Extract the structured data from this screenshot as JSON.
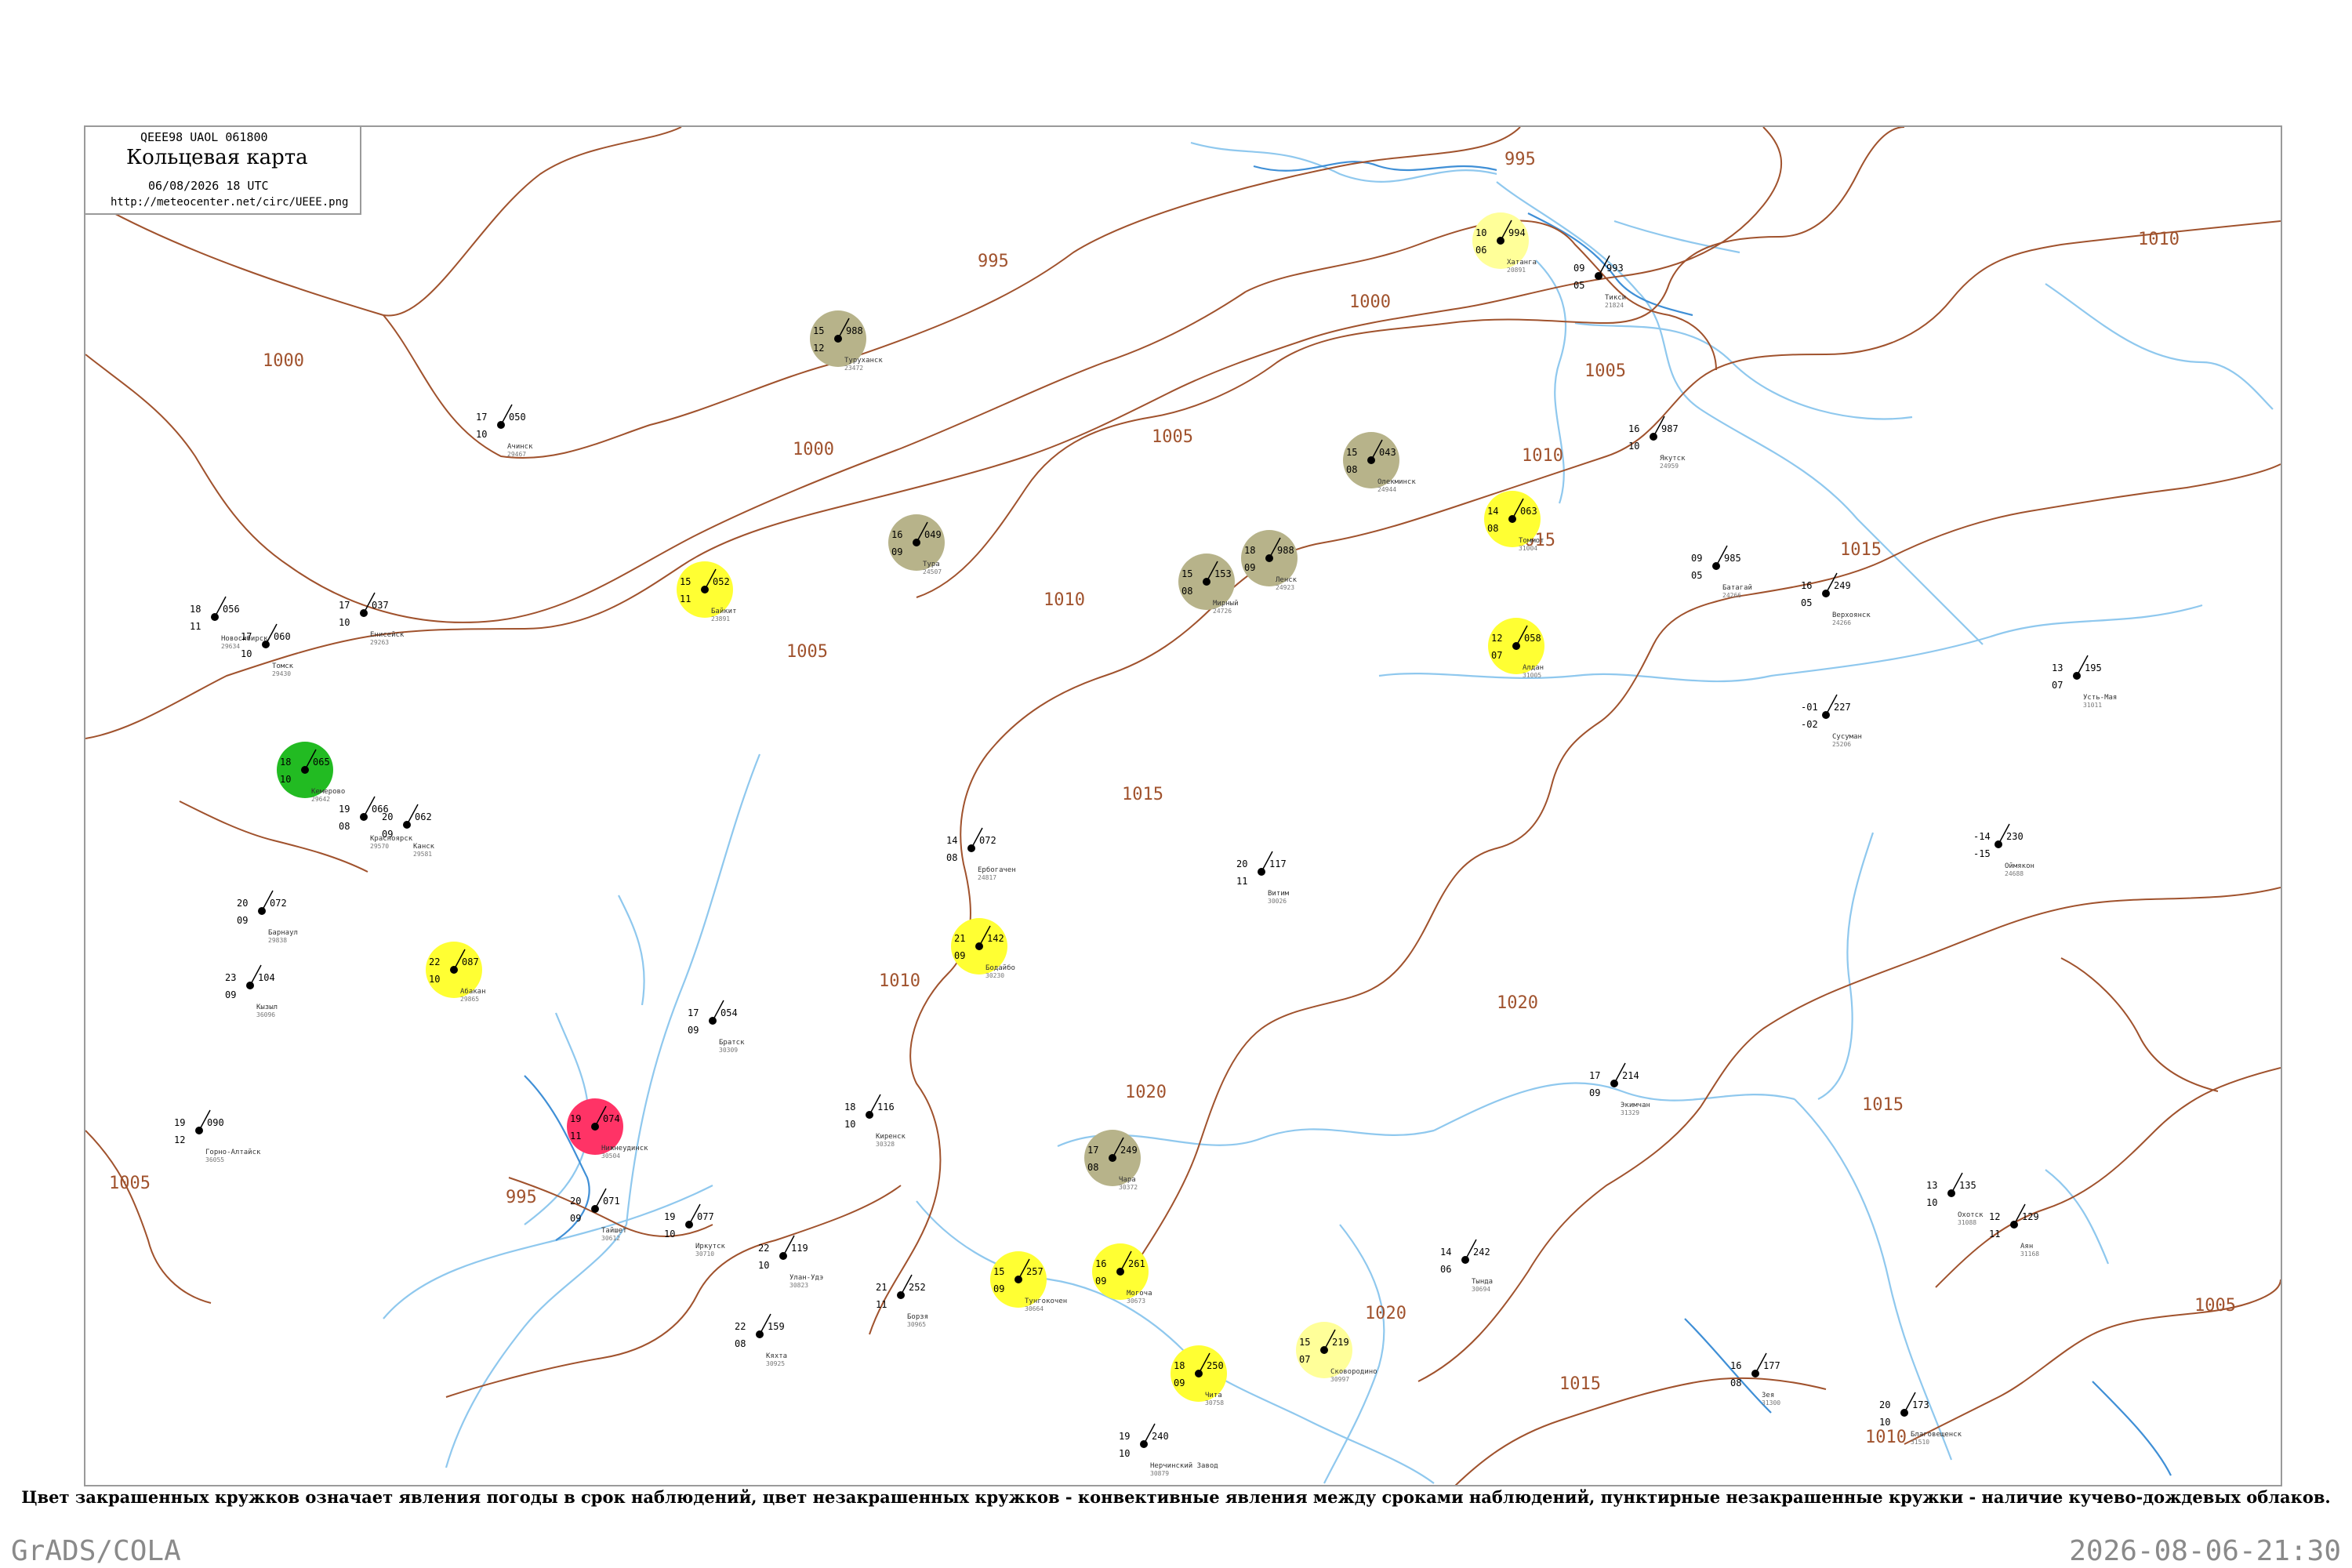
{
  "header": {
    "code_line": "QEEE98  UAOL  061800",
    "title": "Кольцевая карта",
    "datetime": "06/08/2026 18 UTC",
    "url": "http://meteocenter.net/circ/UEEE.png"
  },
  "isobars": {
    "color": "#a0522d",
    "labels": [
      "995",
      "995",
      "1000",
      "1000",
      "1000",
      "1005",
      "1005",
      "1005",
      "1010",
      "1010",
      "1010",
      "1010",
      "1015",
      "1015",
      "1015",
      "1015",
      "1020",
      "1020",
      "1020",
      "1015",
      "1010",
      "1005",
      "995",
      "1005"
    ]
  },
  "stations": [
    {
      "name": "Якутск",
      "index": "24959",
      "temp": "16",
      "dew": "10",
      "pressure": "987",
      "weather_color": "#ffffff"
    },
    {
      "name": "Олекминск",
      "index": "24944",
      "temp": "15",
      "dew": "08",
      "pressure": "043",
      "weather_color": "#b7b38a"
    },
    {
      "name": "Батагай",
      "index": "24266",
      "temp": "09",
      "dew": "05",
      "pressure": "985",
      "weather_color": "#ffffff"
    },
    {
      "name": "Томмот",
      "index": "31004",
      "temp": "14",
      "dew": "08",
      "pressure": "063",
      "weather_color": "#ffff33"
    },
    {
      "name": "Алдан",
      "index": "31005",
      "temp": "12",
      "dew": "07",
      "pressure": "058",
      "weather_color": "#ffff33"
    },
    {
      "name": "Усть-Мая",
      "index": "31011",
      "temp": "13",
      "dew": "07",
      "pressure": "195",
      "weather_color": "#ffffff"
    },
    {
      "name": "Оймякон",
      "index": "24688",
      "temp": "-14",
      "dew": "-15",
      "pressure": "230",
      "weather_color": "#ffffff"
    },
    {
      "name": "Верхоянск",
      "index": "24266",
      "temp": "16",
      "dew": "05",
      "pressure": "249",
      "weather_color": "#ffffff"
    },
    {
      "name": "Ленск",
      "index": "24923",
      "temp": "18",
      "dew": "09",
      "pressure": "988",
      "weather_color": "#b7b38a"
    },
    {
      "name": "Мирный",
      "index": "24726",
      "temp": "15",
      "dew": "08",
      "pressure": "153",
      "weather_color": "#b7b38a"
    },
    {
      "name": "Витим",
      "index": "30026",
      "temp": "20",
      "dew": "11",
      "pressure": "117",
      "weather_color": "#ffffff"
    },
    {
      "name": "Бодайбо",
      "index": "30230",
      "temp": "21",
      "dew": "09",
      "pressure": "142",
      "weather_color": "#ffff33"
    },
    {
      "name": "Чара",
      "index": "30372",
      "temp": "17",
      "dew": "08",
      "pressure": "249",
      "weather_color": "#b7b38a"
    },
    {
      "name": "Тунгокочен",
      "index": "30664",
      "temp": "15",
      "dew": "09",
      "pressure": "257",
      "weather_color": "#ffff33"
    },
    {
      "name": "Чита",
      "index": "30758",
      "temp": "18",
      "dew": "09",
      "pressure": "250",
      "weather_color": "#ffff33"
    },
    {
      "name": "Могоча",
      "index": "30673",
      "temp": "16",
      "dew": "09",
      "pressure": "261",
      "weather_color": "#ffff33"
    },
    {
      "name": "Тында",
      "index": "30694",
      "temp": "14",
      "dew": "06",
      "pressure": "242",
      "weather_color": "#ffffff"
    },
    {
      "name": "Иркутск",
      "index": "30710",
      "temp": "19",
      "dew": "10",
      "pressure": "077",
      "weather_color": "#ffffff"
    },
    {
      "name": "Улан-Удэ",
      "index": "30823",
      "temp": "22",
      "dew": "10",
      "pressure": "119",
      "weather_color": "#ffffff"
    },
    {
      "name": "Братск",
      "index": "30309",
      "temp": "17",
      "dew": "09",
      "pressure": "054",
      "weather_color": "#ffffff"
    },
    {
      "name": "Киренск",
      "index": "30328",
      "temp": "18",
      "dew": "10",
      "pressure": "116",
      "weather_color": "#ffffff"
    },
    {
      "name": "Ербогачен",
      "index": "24817",
      "temp": "14",
      "dew": "08",
      "pressure": "072",
      "weather_color": "#ffffff"
    },
    {
      "name": "Туруханск",
      "index": "23472",
      "temp": "15",
      "dew": "12",
      "pressure": "988",
      "weather_color": "#b7b38a"
    },
    {
      "name": "Тура",
      "index": "24507",
      "temp": "16",
      "dew": "09",
      "pressure": "049",
      "weather_color": "#b7b38a"
    },
    {
      "name": "Байкит",
      "index": "23891",
      "temp": "15",
      "dew": "11",
      "pressure": "052",
      "weather_color": "#ffff33"
    },
    {
      "name": "Енисейск",
      "index": "29263",
      "temp": "17",
      "dew": "10",
      "pressure": "037",
      "weather_color": "#ffffff"
    },
    {
      "name": "Красноярск",
      "index": "29570",
      "temp": "19",
      "dew": "08",
      "pressure": "066",
      "weather_color": "#ffffff"
    },
    {
      "name": "Канск",
      "index": "29581",
      "temp": "20",
      "dew": "09",
      "pressure": "062",
      "weather_color": "#ffffff"
    },
    {
      "name": "Абакан",
      "index": "29865",
      "temp": "22",
      "dew": "10",
      "pressure": "087",
      "weather_color": "#ffff33"
    },
    {
      "name": "Кызыл",
      "index": "36096",
      "temp": "23",
      "dew": "09",
      "pressure": "104",
      "weather_color": "#ffffff"
    },
    {
      "name": "Хатанга",
      "index": "20891",
      "temp": "10",
      "dew": "06",
      "pressure": "994",
      "weather_color": "#ffff99"
    },
    {
      "name": "Тикси",
      "index": "21824",
      "temp": "09",
      "dew": "05",
      "pressure": "993",
      "weather_color": "#ffffff"
    },
    {
      "name": "Сусуман",
      "index": "25206",
      "temp": "-01",
      "dew": "-02",
      "pressure": "227",
      "weather_color": "#ffffff"
    },
    {
      "name": "Зея",
      "index": "31300",
      "temp": "16",
      "dew": "08",
      "pressure": "177",
      "weather_color": "#ffffff"
    },
    {
      "name": "Благовещенск",
      "index": "31510",
      "temp": "20",
      "dew": "10",
      "pressure": "173",
      "weather_color": "#ffffff"
    },
    {
      "name": "Сковородино",
      "index": "30997",
      "temp": "15",
      "dew": "07",
      "pressure": "219",
      "weather_color": "#ffff99"
    },
    {
      "name": "Нерчинский Завод",
      "index": "30879",
      "temp": "19",
      "dew": "10",
      "pressure": "240",
      "weather_color": "#ffffff"
    },
    {
      "name": "Борзя",
      "index": "30965",
      "temp": "21",
      "dew": "11",
      "pressure": "252",
      "weather_color": "#ffffff"
    },
    {
      "name": "Кяхта",
      "index": "30925",
      "temp": "22",
      "dew": "08",
      "pressure": "159",
      "weather_color": "#ffffff"
    },
    {
      "name": "Новосибирск",
      "index": "29634",
      "temp": "18",
      "dew": "11",
      "pressure": "056",
      "weather_color": "#ffffff"
    },
    {
      "name": "Томск",
      "index": "29430",
      "temp": "17",
      "dew": "10",
      "pressure": "060",
      "weather_color": "#ffffff"
    },
    {
      "name": "Барнаул",
      "index": "29838",
      "temp": "20",
      "dew": "09",
      "pressure": "072",
      "weather_color": "#ffffff"
    },
    {
      "name": "Горно-Алтайск",
      "index": "36055",
      "temp": "19",
      "dew": "12",
      "pressure": "090",
      "weather_color": "#ffffff"
    },
    {
      "name": "Кемерово",
      "index": "29642",
      "temp": "18",
      "dew": "10",
      "pressure": "065",
      "weather_color": "#22bb22"
    },
    {
      "name": "Ачинск",
      "index": "29467",
      "temp": "17",
      "dew": "10",
      "pressure": "050",
      "weather_color": "#ffffff"
    },
    {
      "name": "Нижнеудинск",
      "index": "30504",
      "temp": "19",
      "dew": "11",
      "pressure": "074",
      "weather_color": "#ff3366"
    },
    {
      "name": "Тайшет",
      "index": "30612",
      "temp": "20",
      "dew": "09",
      "pressure": "071",
      "weather_color": "#ffffff"
    },
    {
      "name": "Охотск",
      "index": "31088",
      "temp": "13",
      "dew": "10",
      "pressure": "135",
      "weather_color": "#ffffff"
    },
    {
      "name": "Аян",
      "index": "31168",
      "temp": "12",
      "dew": "11",
      "pressure": "129",
      "weather_color": "#ffffff"
    },
    {
      "name": "Экимчан",
      "index": "31329",
      "temp": "17",
      "dew": "09",
      "pressure": "214",
      "weather_color": "#ffffff"
    }
  ],
  "legend_note": "Цвет закрашенных кружков означает явления погоды в срок наблюдений, цвет незакрашенных кружков - конвективные явления между сроками наблюдений, пунктирные незакрашенные кружки - наличие кучево-дождевых облаков.",
  "footer": {
    "left": "GrADS/COLA",
    "right": "2026-08-06-21:30"
  }
}
